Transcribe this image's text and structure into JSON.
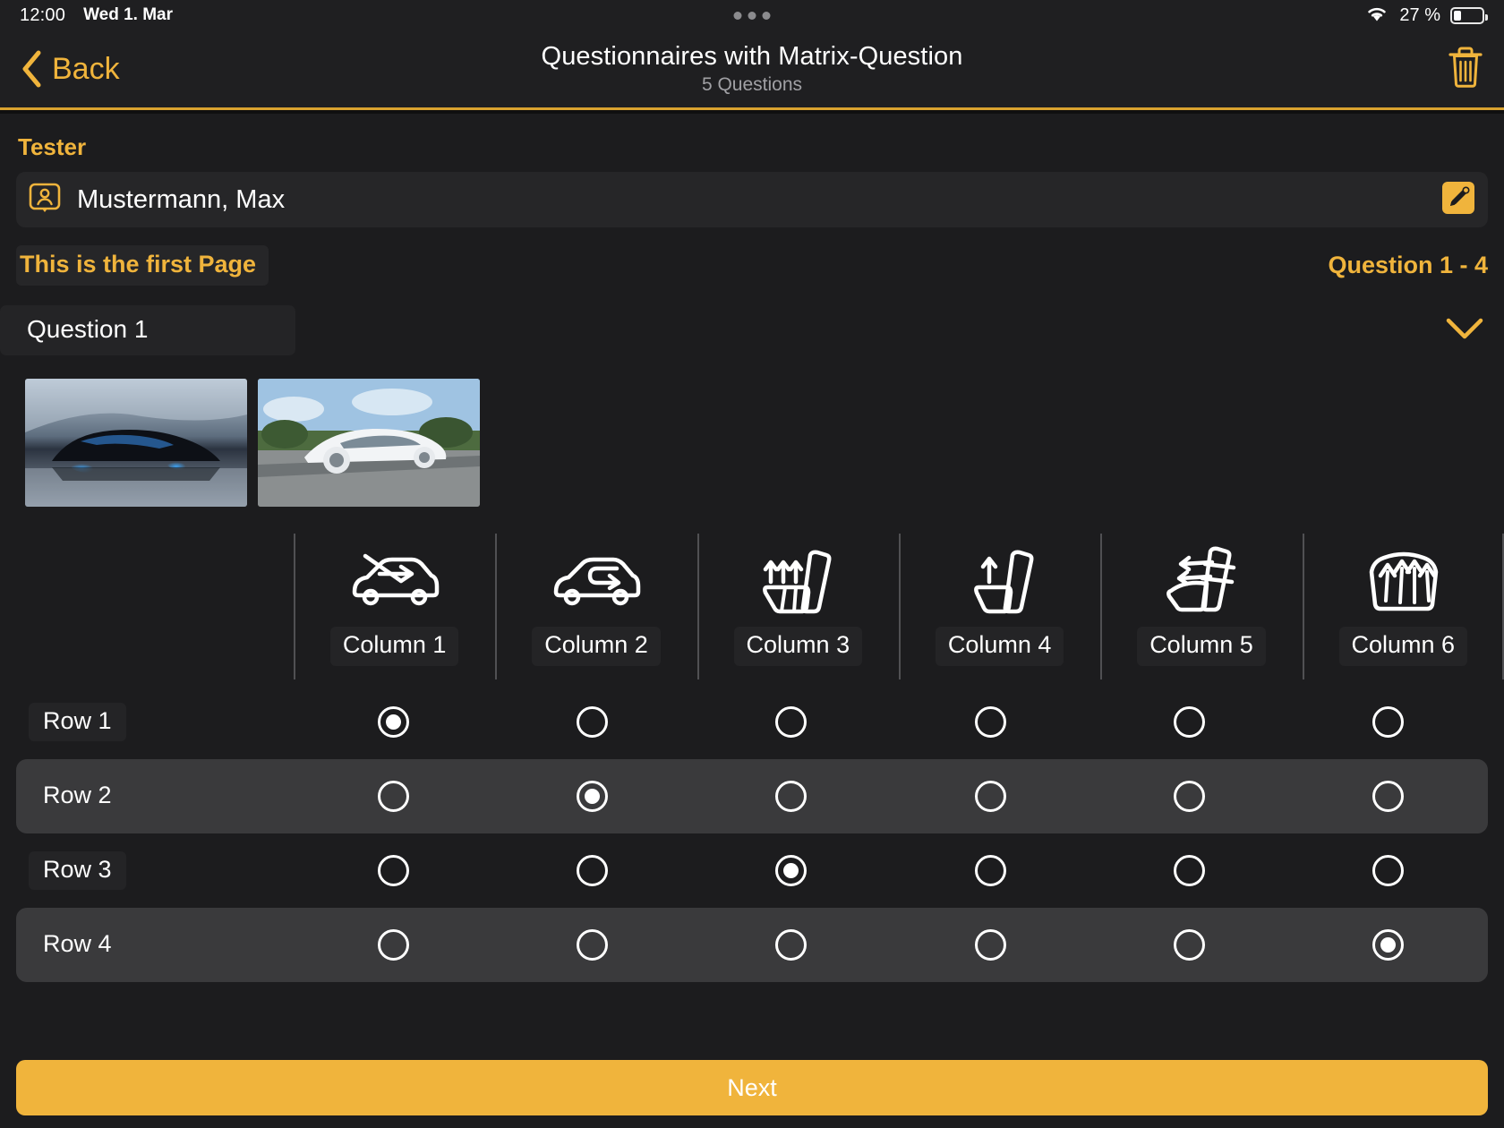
{
  "status_bar": {
    "time": "12:00",
    "date": "Wed 1. Mar",
    "battery_percent": "27 %",
    "wifi_icon": "wifi-icon",
    "battery_icon": "battery-icon",
    "dots_icon": "handle-dots-icon"
  },
  "navbar": {
    "back_label": "Back",
    "back_icon": "chevron-left-icon",
    "title": "Questionnaires with Matrix-Question",
    "subtitle": "5 Questions",
    "delete_icon": "trash-icon"
  },
  "tester": {
    "section_label": "Tester",
    "person_icon": "contact-card-icon",
    "name": "Mustermann, Max",
    "edit_icon": "edit-pencil-icon"
  },
  "page": {
    "page_label": "This is the first Page",
    "question_range": "Question 1 - 4"
  },
  "question": {
    "title": "Question 1",
    "collapse_icon": "chevron-down-icon",
    "images": [
      {
        "name": "black-sports-car-thumbnail"
      },
      {
        "name": "white-concept-car-thumbnail"
      }
    ]
  },
  "matrix": {
    "columns": [
      {
        "label": "Column 1",
        "icon": "car-fresh-air-icon"
      },
      {
        "label": "Column 2",
        "icon": "car-recirculation-icon"
      },
      {
        "label": "Column 3",
        "icon": "seat-ventilation-icon"
      },
      {
        "label": "Column 4",
        "icon": "seat-single-airflow-icon"
      },
      {
        "label": "Column 5",
        "icon": "seat-heating-back-icon"
      },
      {
        "label": "Column 6",
        "icon": "seat-backrest-airflow-icon"
      }
    ],
    "rows": [
      {
        "label": "Row 1",
        "selected": 0
      },
      {
        "label": "Row 2",
        "selected": 1
      },
      {
        "label": "Row 3",
        "selected": 2
      },
      {
        "label": "Row 4",
        "selected": 5
      }
    ]
  },
  "footer": {
    "next_label": "Next"
  },
  "colors": {
    "accent": "#f0b43c",
    "background": "#1c1c1e",
    "row_alt": "#3a3a3c",
    "chip": "#242426"
  }
}
